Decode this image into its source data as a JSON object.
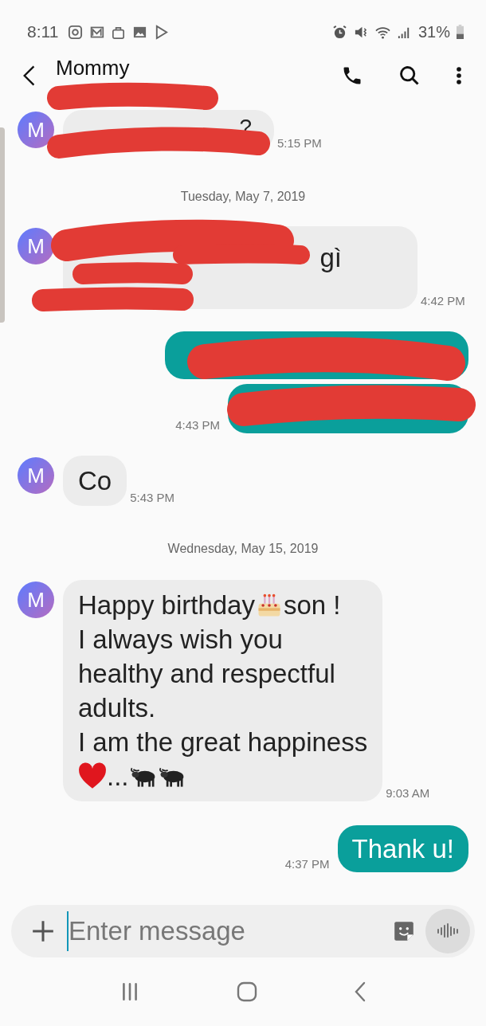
{
  "status_bar": {
    "time": "8:11",
    "battery": "31%"
  },
  "header": {
    "title": "Mommy"
  },
  "items": [
    {
      "kind": "incoming",
      "avatar": "M",
      "redacted": true,
      "time": "5:15 PM",
      "lines": [
        {
          "parts": [
            {
              "kind": "text",
              "text": "?"
            }
          ]
        }
      ]
    },
    {
      "kind": "date",
      "text": "Tuesday, May 7, 2019"
    },
    {
      "kind": "incoming",
      "avatar": "M",
      "redacted": true,
      "time": "4:42 PM",
      "lines": [
        {
          "parts": [
            {
              "kind": "text",
              "text": "gì"
            }
          ]
        }
      ]
    },
    {
      "kind": "outgoing",
      "redacted": true
    },
    {
      "kind": "outgoing",
      "redacted": true,
      "time": "4:43 PM"
    },
    {
      "kind": "incoming",
      "avatar": "M",
      "redacted": false,
      "time": "5:43 PM",
      "lines": [
        {
          "parts": [
            {
              "kind": "text",
              "text": "Co"
            }
          ]
        }
      ]
    },
    {
      "kind": "date",
      "text": "Wednesday, May 15, 2019"
    },
    {
      "kind": "incoming",
      "avatar": "M",
      "redacted": false,
      "time": "9:03 AM",
      "lines": [
        {
          "parts": [
            {
              "kind": "text",
              "text": "Happy birthday"
            },
            {
              "kind": "cake"
            },
            {
              "kind": "text",
              "text": "son !"
            }
          ]
        },
        {
          "parts": [
            {
              "kind": "text",
              "text": "I always wish you"
            }
          ]
        },
        {
          "parts": [
            {
              "kind": "text",
              "text": "healthy and respectful"
            }
          ]
        },
        {
          "parts": [
            {
              "kind": "text",
              "text": "adults."
            }
          ]
        },
        {
          "parts": [
            {
              "kind": "text",
              "text": "I am the great happiness"
            }
          ]
        },
        {
          "parts": [
            {
              "kind": "heart"
            },
            {
              "kind": "text",
              "text": "..."
            },
            {
              "kind": "buffalo"
            },
            {
              "kind": "buffalo"
            }
          ]
        }
      ]
    },
    {
      "kind": "outgoing",
      "redacted": false,
      "time": "4:37 PM",
      "lines": [
        {
          "parts": [
            {
              "kind": "text",
              "text": "Thank u!"
            }
          ]
        }
      ]
    }
  ],
  "composer": {
    "placeholder": "Enter message"
  }
}
